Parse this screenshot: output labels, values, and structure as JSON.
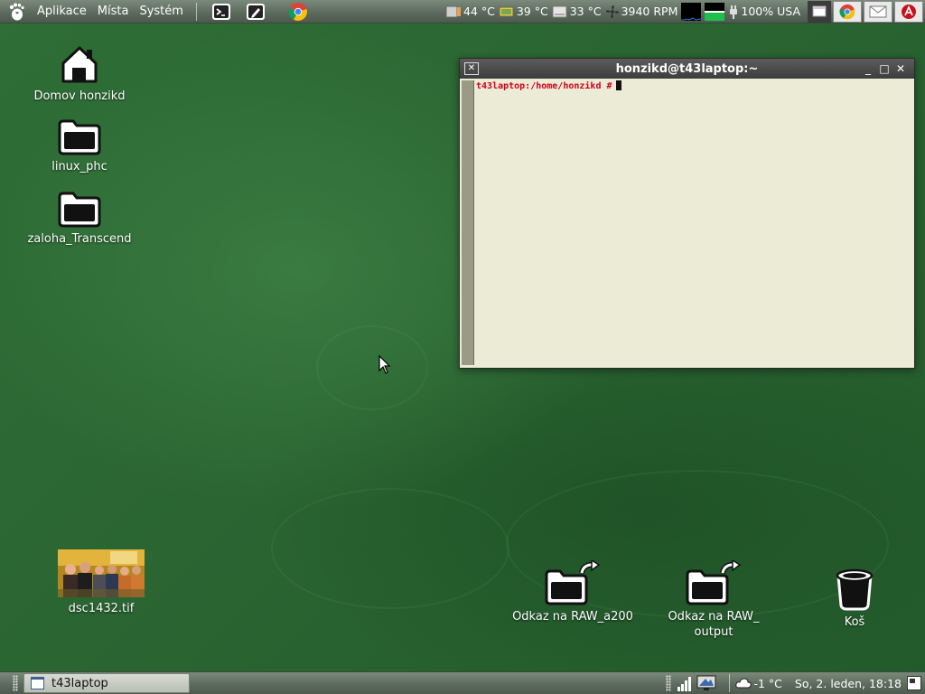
{
  "top_panel": {
    "menus": [
      "Aplikace",
      "Místa",
      "Systém"
    ],
    "launchers": [
      "terminal-icon",
      "text-editor-icon",
      "chrome-icon"
    ],
    "sensors": {
      "cpu_temp": "44 °C",
      "gpu_temp": "39 °C",
      "hdd_temp": "33 °C",
      "fan_speed": "3940 RPM"
    },
    "battery": "100%",
    "keyboard_layout": "USA",
    "tray_apps": [
      "chrome-icon",
      "mail-icon",
      "acrobat-icon"
    ]
  },
  "desktop_icons": [
    {
      "label": "Domov honzikd",
      "icon": "home-icon"
    },
    {
      "label": "linux_phc",
      "icon": "folder-icon"
    },
    {
      "label": "zaloha_Transcend",
      "icon": "folder-icon"
    },
    {
      "label": "dsc1432.tif",
      "icon": "image-thumbnail"
    },
    {
      "label": "Odkaz na RAW_a200",
      "icon": "folder-link-icon"
    },
    {
      "label": "Odkaz na RAW_\noutput",
      "icon": "folder-link-icon"
    },
    {
      "label": "Koš",
      "icon": "trash-icon"
    }
  ],
  "terminal": {
    "title": "honzikd@t43laptop:~",
    "prompt": "t43laptop:/home/honzikd #"
  },
  "bottom_panel": {
    "task": "t43laptop",
    "weather": "-1 °C",
    "clock": "So,  2. leden, 18:18"
  },
  "colors": {
    "desktop_green": "#2a6532",
    "panel_gray": "#5d6b5e",
    "terminal_bg": "#ecebd5",
    "prompt_red": "#d0001b"
  }
}
